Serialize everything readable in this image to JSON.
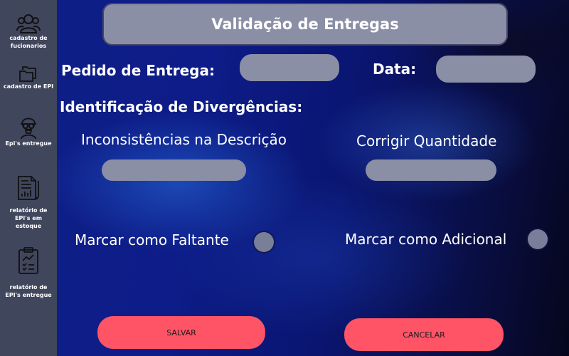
{
  "sidebar": {
    "items": [
      {
        "label": "cadastro de fucionarios",
        "icon": "users-group-icon"
      },
      {
        "label": "cadastro de EPI",
        "icon": "folders-icon"
      },
      {
        "label": "Epi's entregue",
        "icon": "worker-mask-icon"
      },
      {
        "label": "relatório de EPI's em estoque",
        "icon": "report-chart-icon"
      },
      {
        "label": "relatório de EPI's entregue",
        "icon": "clipboard-chart-icon"
      }
    ]
  },
  "header": {
    "title": "Validação de Entregas"
  },
  "form": {
    "order_label": "Pedido de Entrega:",
    "order_value": "",
    "date_label": "Data:",
    "date_value": "",
    "divergence_label": "Identificação de Divergências:",
    "description_label": "Inconsistências na Descrição",
    "description_value": "",
    "quantity_label": "Corrigir Quantidade",
    "quantity_value": "",
    "missing_label": "Marcar como Faltante",
    "missing_checked": false,
    "additional_label": "Marcar como Adicional",
    "additional_checked": false
  },
  "actions": {
    "save_label": "SALVAR",
    "cancel_label": "CANCELAR"
  },
  "colors": {
    "sidebar_bg": "#40465c",
    "field_bg": "#8a8fa5",
    "button_bg": "#ff5466",
    "background_blue": "#0f1f86"
  }
}
